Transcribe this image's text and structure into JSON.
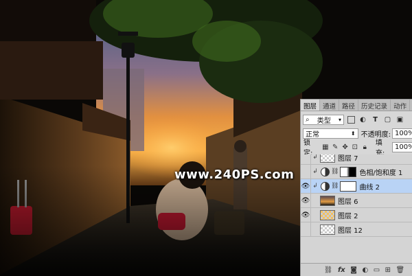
{
  "watermark": "www.240PS.com",
  "panel": {
    "tabs": [
      "图层",
      "通道",
      "路径",
      "历史记录",
      "动作"
    ],
    "active_tab": "图层",
    "filter": {
      "label": "类型",
      "icons": [
        "image-filter-icon",
        "adjustment-filter-icon",
        "type-filter-icon",
        "shape-filter-icon",
        "smart-object-filter-icon"
      ]
    },
    "blend_mode": "正常",
    "opacity_label": "不透明度:",
    "opacity_value": "100%",
    "lock_label": "锁定:",
    "fill_label": "填充:",
    "fill_value": "100%",
    "layers": [
      {
        "name": "图层 7",
        "visible": false,
        "clipped": true,
        "kind": "pixel",
        "selected": false
      },
      {
        "name": "色相/饱和度 1",
        "visible": false,
        "clipped": true,
        "kind": "adjustment-hue",
        "selected": false
      },
      {
        "name": "曲线 2",
        "visible": true,
        "clipped": true,
        "kind": "adjustment-curves",
        "selected": true
      },
      {
        "name": "图层 6",
        "visible": true,
        "clipped": false,
        "kind": "photo",
        "selected": false
      },
      {
        "name": "图层 2",
        "visible": true,
        "clipped": false,
        "kind": "pixel",
        "selected": false
      },
      {
        "name": "图层 12",
        "visible": false,
        "clipped": false,
        "kind": "pixel",
        "selected": false
      }
    ],
    "bottom_icons": [
      "link-icon",
      "fx-icon",
      "add-mask-icon",
      "new-adjustment-icon",
      "new-group-icon",
      "new-layer-icon",
      "trash-icon"
    ],
    "fx_label": "fx"
  }
}
